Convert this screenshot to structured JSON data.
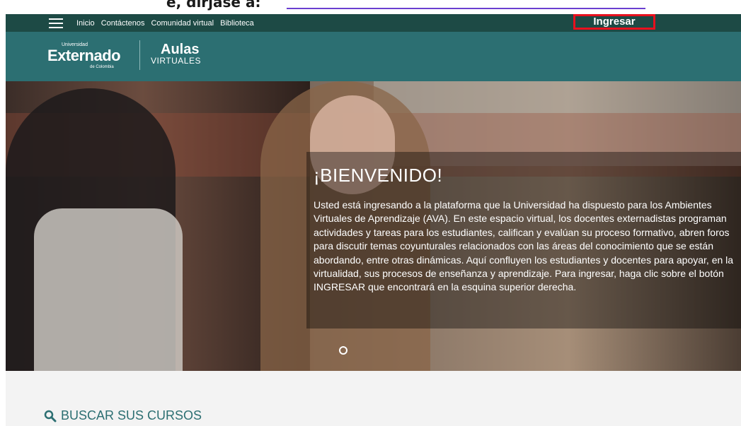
{
  "browser_fragment": {
    "text": "e, dirjase a:",
    "link_visible": true
  },
  "navbar": {
    "links": [
      {
        "label": "Inicio"
      },
      {
        "label": "Contáctenos"
      },
      {
        "label": "Comunidad virtual"
      },
      {
        "label": "Biblioteca"
      }
    ],
    "login_label": "Ingresar",
    "menu_icon": "hamburger-menu-icon",
    "highlight_color": "#e8101e"
  },
  "branding": {
    "university_small": "Universidad",
    "university_name": "Externado",
    "university_sub": "de Colombia",
    "aulas_top": "Aulas",
    "aulas_bottom": "VIRTUALES"
  },
  "hero": {
    "title": "¡BIENVENIDO!",
    "text": "Usted está ingresando a la plataforma que la Universidad ha dispuesto para los Ambientes Virtuales de Aprendizaje (AVA). En este espacio virtual, los docentes externadistas programan actividades y tareas para los estudiantes, califican y evalúan su proceso formativo, abren foros para discutir temas coyunturales relacionados con las áreas del conocimiento que se están abordando, entre otras dinámicas. Aquí confluyen los estudiantes y docentes para apoyar, en la virtualidad, sus procesos de enseñanza y aprendizaje. Para ingresar, haga clic sobre el botón INGRESAR que encontrará en la esquina superior derecha."
  },
  "search": {
    "title": "BUSCAR SUS CURSOS",
    "icon": "search-icon"
  },
  "colors": {
    "navbar": "#1d4a45",
    "brandbar": "#2c6f72",
    "accent": "#2c6f72"
  }
}
